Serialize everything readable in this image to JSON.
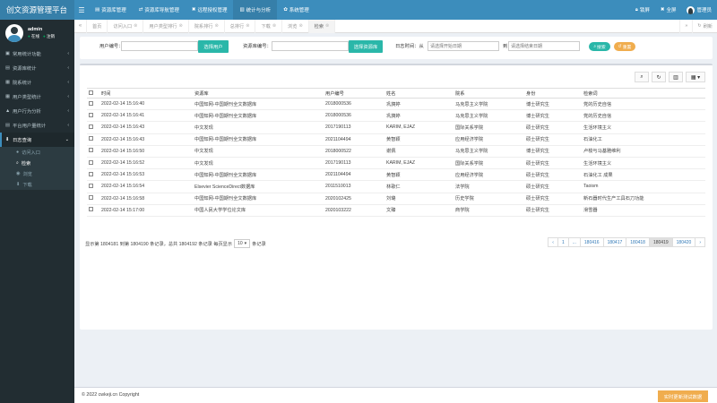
{
  "app": {
    "title": "创文资源管理平台"
  },
  "topnav": [
    {
      "icon": "database-icon",
      "glyph": "▤",
      "label": "资源库管理",
      "active": false
    },
    {
      "icon": "exchange-icon",
      "glyph": "⇄",
      "label": "资源库导航管理",
      "active": false
    },
    {
      "icon": "wrench-icon",
      "glyph": "✖",
      "label": "远程授权管理",
      "active": false
    },
    {
      "icon": "chart-icon",
      "glyph": "▥",
      "label": "统计与分析",
      "active": true
    },
    {
      "icon": "gear-icon",
      "glyph": "✿",
      "label": "系统管理",
      "active": false
    }
  ],
  "topright": {
    "lock_label": "锁屏",
    "fullscreen_label": "全屏",
    "user_label": "管理员"
  },
  "user": {
    "name": "admin",
    "status": "在线",
    "logout": "注销"
  },
  "sidebar": {
    "items": [
      {
        "label": "常用统计功能",
        "icon": "▣",
        "chevron": "‹"
      },
      {
        "label": "资源库统计",
        "icon": "▤",
        "chevron": "‹"
      },
      {
        "label": "院系统计",
        "icon": "▦",
        "chevron": "‹"
      },
      {
        "label": "用户类型统计",
        "icon": "▦",
        "chevron": "‹"
      },
      {
        "label": "用户行为分析",
        "icon": "▲",
        "chevron": "‹"
      },
      {
        "label": "平台用户量统计",
        "icon": "▤",
        "chevron": "‹"
      }
    ],
    "open_item": {
      "label": "日志查询",
      "icon": "⬇",
      "chevron": "⌄"
    },
    "subitems": [
      {
        "label": "访问入口",
        "icon": "●"
      },
      {
        "label": "检索",
        "icon": "⌕"
      },
      {
        "label": "浏览",
        "icon": "◉"
      },
      {
        "label": "下载",
        "icon": "⬇"
      }
    ]
  },
  "tabs": [
    {
      "label": "首页",
      "close": ""
    },
    {
      "label": "访问入口",
      "close": "⊗"
    },
    {
      "label": "用户类型排行",
      "close": "⊗"
    },
    {
      "label": "院系排行",
      "close": "⊗"
    },
    {
      "label": "总排行",
      "close": "⊗"
    },
    {
      "label": "下载",
      "close": "⊗"
    },
    {
      "label": "浏览",
      "close": "⊗"
    },
    {
      "label": "检索",
      "close": "⊗",
      "active": true
    }
  ],
  "tabbar": {
    "left_arrow": "«",
    "right_arrow": "»",
    "close_label": "⊗",
    "refresh_label": "刷新"
  },
  "search": {
    "user_no_label": "用户编号：",
    "select_user_btn": "选择用户",
    "resource_no_label": "资源库编号：",
    "select_resource_btn": "选择资源库",
    "date_label": "日志时间：从",
    "date_from_placeholder": "请选择开始日期",
    "date_to_label": "到",
    "date_to_placeholder": "请选择结束日期",
    "search_btn": "搜索",
    "reset_btn": "重置"
  },
  "table": {
    "columns": [
      "时间",
      "资源库",
      "用户编号",
      "姓名",
      "院系",
      "身份",
      "检索词"
    ],
    "rows": [
      [
        "2022-02-14 15:16:40",
        "中国知网-中国期刊全文数据库",
        "2018000536",
        "巩旖婷",
        "马克思主义学院",
        "博士研究生",
        "党的历史自信"
      ],
      [
        "2022-02-14 15:16:41",
        "中国知网-中国期刊全文数据库",
        "2018000536",
        "巩旖婷",
        "马克思主义学院",
        "博士研究生",
        "党的历史自信"
      ],
      [
        "2022-02-14 15:16:43",
        "中文发现",
        "2017190113",
        "KARIM, EJAZ",
        "国际关系学院",
        "硕士研究生",
        "生活环境主义"
      ],
      [
        "2022-02-14 15:16:43",
        "中国知网-中国期刊全文数据库",
        "2021104494",
        "黄智颖",
        "应用经济学院",
        "硕士研究生",
        "石油化工"
      ],
      [
        "2022-02-14 15:16:50",
        "中文发现",
        "2018000522",
        "谢佩",
        "马克思主义学院",
        "博士研究生",
        "卢梭与马基雅维利"
      ],
      [
        "2022-02-14 15:16:52",
        "中文发现",
        "2017190113",
        "KARIM, EJAZ",
        "国际关系学院",
        "硕士研究生",
        "生活环境主义"
      ],
      [
        "2022-02-14 15:16:53",
        "中国知网-中国期刊全文数据库",
        "2021104494",
        "黄智颖",
        "应用经济学院",
        "硕士研究生",
        "石油化工 成果"
      ],
      [
        "2022-02-14 15:16:54",
        "Elsevier ScienceDirect数据库",
        "2011510013",
        "林歌仁",
        "法学院",
        "硕士研究生",
        "Taoism"
      ],
      [
        "2022-02-14 15:16:58",
        "中国知网-中国期刊全文数据库",
        "2020102425",
        "刘璐",
        "历史学院",
        "硕士研究生",
        "新石器时代生产工具石刀功能"
      ],
      [
        "2022-02-14 15:17:00",
        "中国人民大学学位论文库",
        "2020103222",
        "文臻",
        "商学院",
        "硕士研究生",
        "滑雪器"
      ]
    ]
  },
  "pager": {
    "info_before": "显示第 1804181 到第 1804190 条记录，总共 1804192 条记录   每页显示",
    "page_size": "10",
    "info_after": "条记录",
    "pages": [
      "‹",
      "1",
      "...",
      "180416",
      "180417",
      "180418",
      "180419",
      "180420",
      "›"
    ],
    "active_page": "180419"
  },
  "toolbar": {
    "search": "⌕",
    "refresh": "↻",
    "columns": "▥",
    "export": "▦ ▾"
  },
  "footer": {
    "copyright": "© 2022 cwkeji.cn Copyright",
    "cta": "实时更新测试数据"
  },
  "colors": {
    "topbar": "#3c8dbc",
    "sidebar": "#222d32",
    "teal": "#2ab7a9",
    "orange": "#f0ad4e"
  }
}
